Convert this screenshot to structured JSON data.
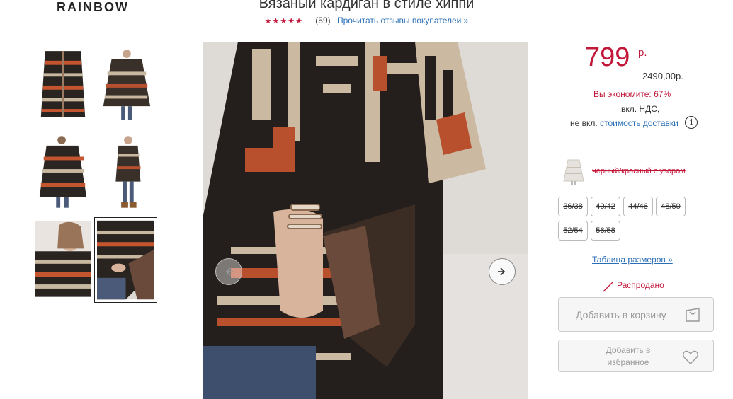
{
  "header": {
    "brand": "RAINBOW"
  },
  "product": {
    "title": "Вязаный кардиган в стиле хиппи",
    "stars": "★★★★★",
    "review_count": "(59)",
    "review_link": "Прочитать отзывы покупателей »"
  },
  "gallery": {
    "thumbnails": [
      {
        "name": "thumb-1",
        "active": false
      },
      {
        "name": "thumb-2",
        "active": false
      },
      {
        "name": "thumb-3",
        "active": false
      },
      {
        "name": "thumb-4",
        "active": false
      },
      {
        "name": "thumb-5",
        "active": false
      },
      {
        "name": "thumb-6",
        "active": true
      }
    ],
    "prev_icon": "chevron-left-icon",
    "next_icon": "chevron-right-icon"
  },
  "pricing": {
    "price": "799",
    "currency": "р.",
    "old_price": "2490,00р.",
    "save_text": "Вы экономите: 67%",
    "vat_text": "вкл. НДС,",
    "delivery_prefix": "не вкл.",
    "delivery_link": "стоимость доставки",
    "info_icon": "i"
  },
  "variant": {
    "color_name": "черный/красный с узором",
    "sizes": [
      "36/38",
      "40/42",
      "44/46",
      "48/50",
      "52/54",
      "56/58"
    ],
    "size_table_link": "Таблица размеров »",
    "status": "Распродано"
  },
  "actions": {
    "add_to_cart": "Добавить в корзину",
    "add_to_favorites": "Добавить в избранное"
  },
  "colors": {
    "accent": "#c3173a",
    "link": "#2a6fb6"
  }
}
